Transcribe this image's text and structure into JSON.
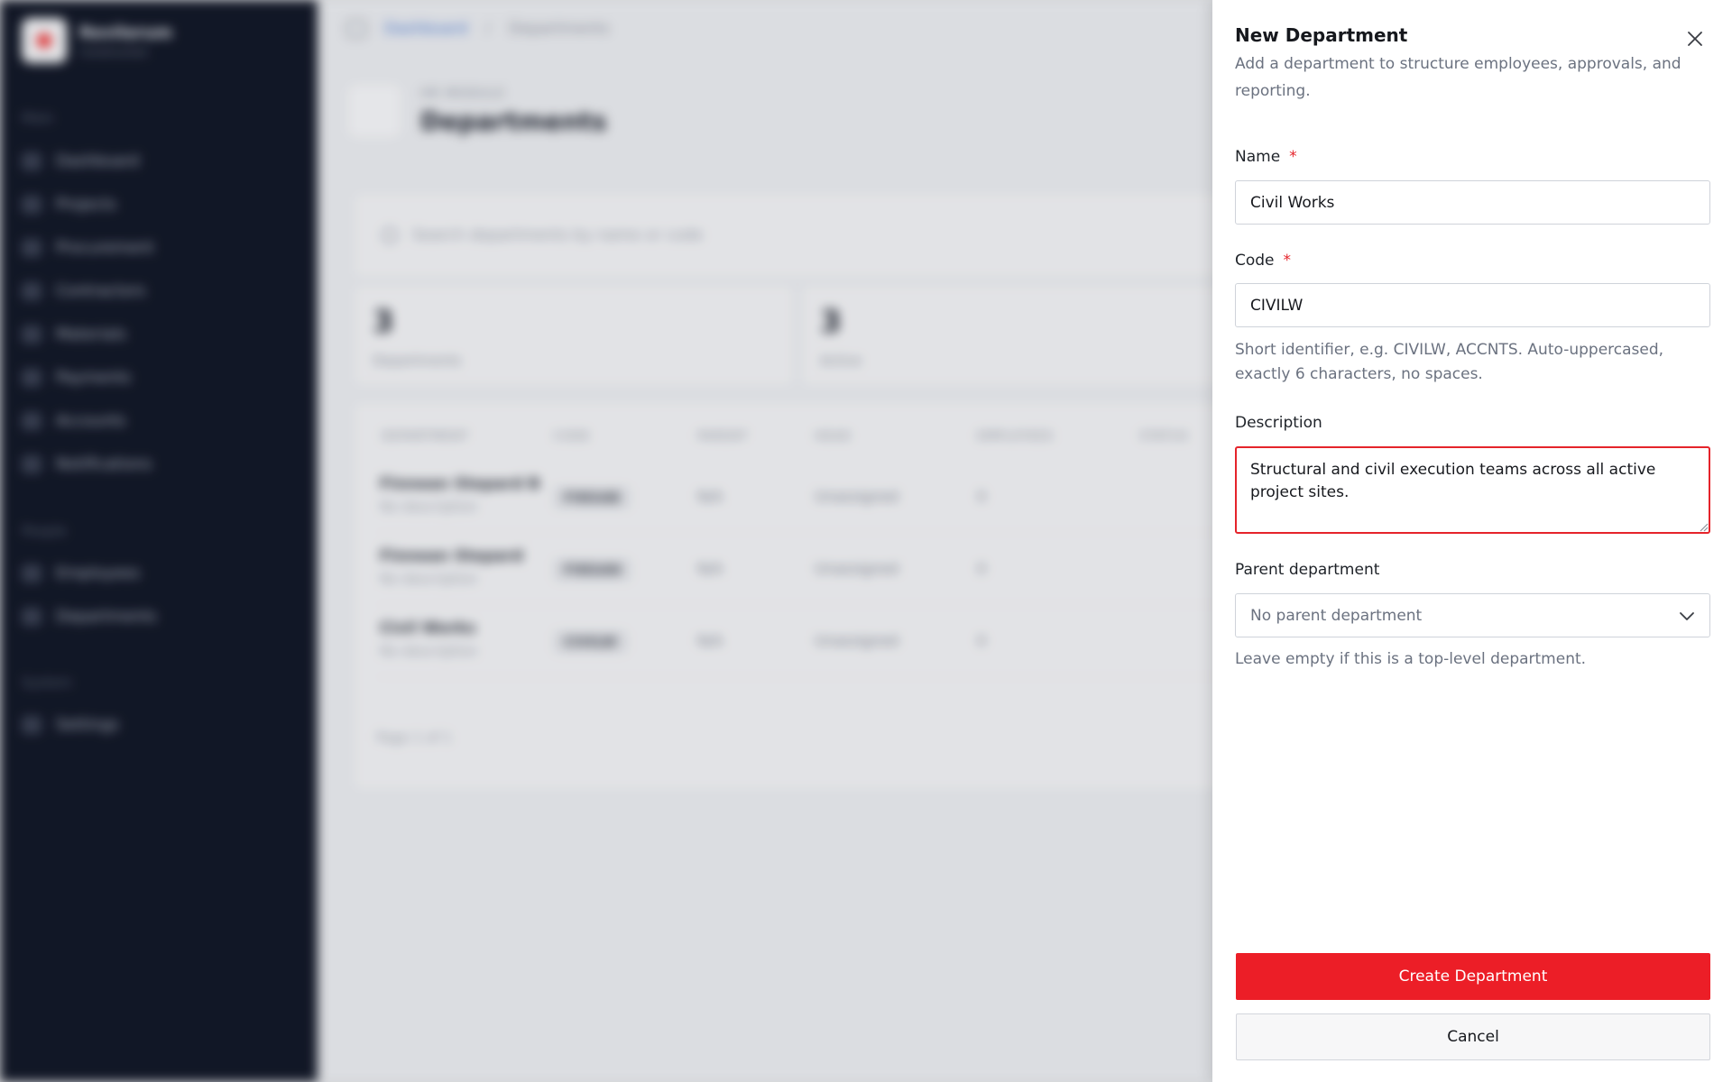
{
  "app": {
    "brand_name": "Revilorum",
    "brand_sub": "Construction",
    "nav_sections": [
      "Main",
      "People",
      "System"
    ],
    "nav_main": [
      "Dashboard",
      "Projects",
      "Procurement",
      "Contractors",
      "Materials",
      "Payments",
      "Accounts",
      "Notifications"
    ],
    "nav_people": [
      "Employees",
      "Departments"
    ],
    "nav_system": [
      "Settings"
    ],
    "breadcrumb_home": "Dashboard",
    "breadcrumb_sep": "/",
    "breadcrumb_current": "Departments",
    "page_eyebrow": "HR MODULE",
    "page_title": "Departments",
    "search_placeholder": "Search departments by name or code",
    "stats": [
      {
        "value": "3",
        "label": "Departments"
      },
      {
        "value": "3",
        "label": "Active"
      }
    ],
    "table_headers": [
      "DEPARTMENT",
      "CODE",
      "PARENT",
      "HEAD",
      "EMPLOYEES",
      "STATUS"
    ],
    "rows": [
      {
        "name": "Finnean Stepard B",
        "desc": "No description",
        "code": "FINSAB",
        "parent": "N/A",
        "head": "Unassigned",
        "employees": "0"
      },
      {
        "name": "Finnean Stepard",
        "desc": "No description",
        "code": "FINSAN",
        "parent": "N/A",
        "head": "Unassigned",
        "employees": "0"
      },
      {
        "name": "Civil Works",
        "desc": "No description",
        "code": "CIVILW",
        "parent": "N/A",
        "head": "Unassigned",
        "employees": "0"
      }
    ],
    "pager": "Page 1 of 1"
  },
  "drawer": {
    "title": "New Department",
    "subtitle": "Add a department to structure employees, approvals, and reporting.",
    "name_label": "Name",
    "name_required": "*",
    "name_value": "Civil Works",
    "code_label": "Code",
    "code_required": "*",
    "code_value": "CIVILW",
    "code_help": "Short identifier, e.g. CIVILW, ACCNTS. Auto-uppercased, exactly 6 characters, no spaces.",
    "description_label": "Description",
    "description_value": "Structural and civil execution teams across all active project sites.",
    "parent_label": "Parent department",
    "parent_value": "No parent department",
    "parent_help": "Leave empty if this is a top-level department.",
    "create_label": "Create Department",
    "cancel_label": "Cancel"
  },
  "colors": {
    "accent": "#ec1e27",
    "sidebar_bg": "#111726",
    "error_border": "#e5242b"
  },
  "icons": [
    "close-icon",
    "chevron-down-icon",
    "resize-grip-icon",
    "search-icon",
    "sidebar-toggle-icon"
  ]
}
